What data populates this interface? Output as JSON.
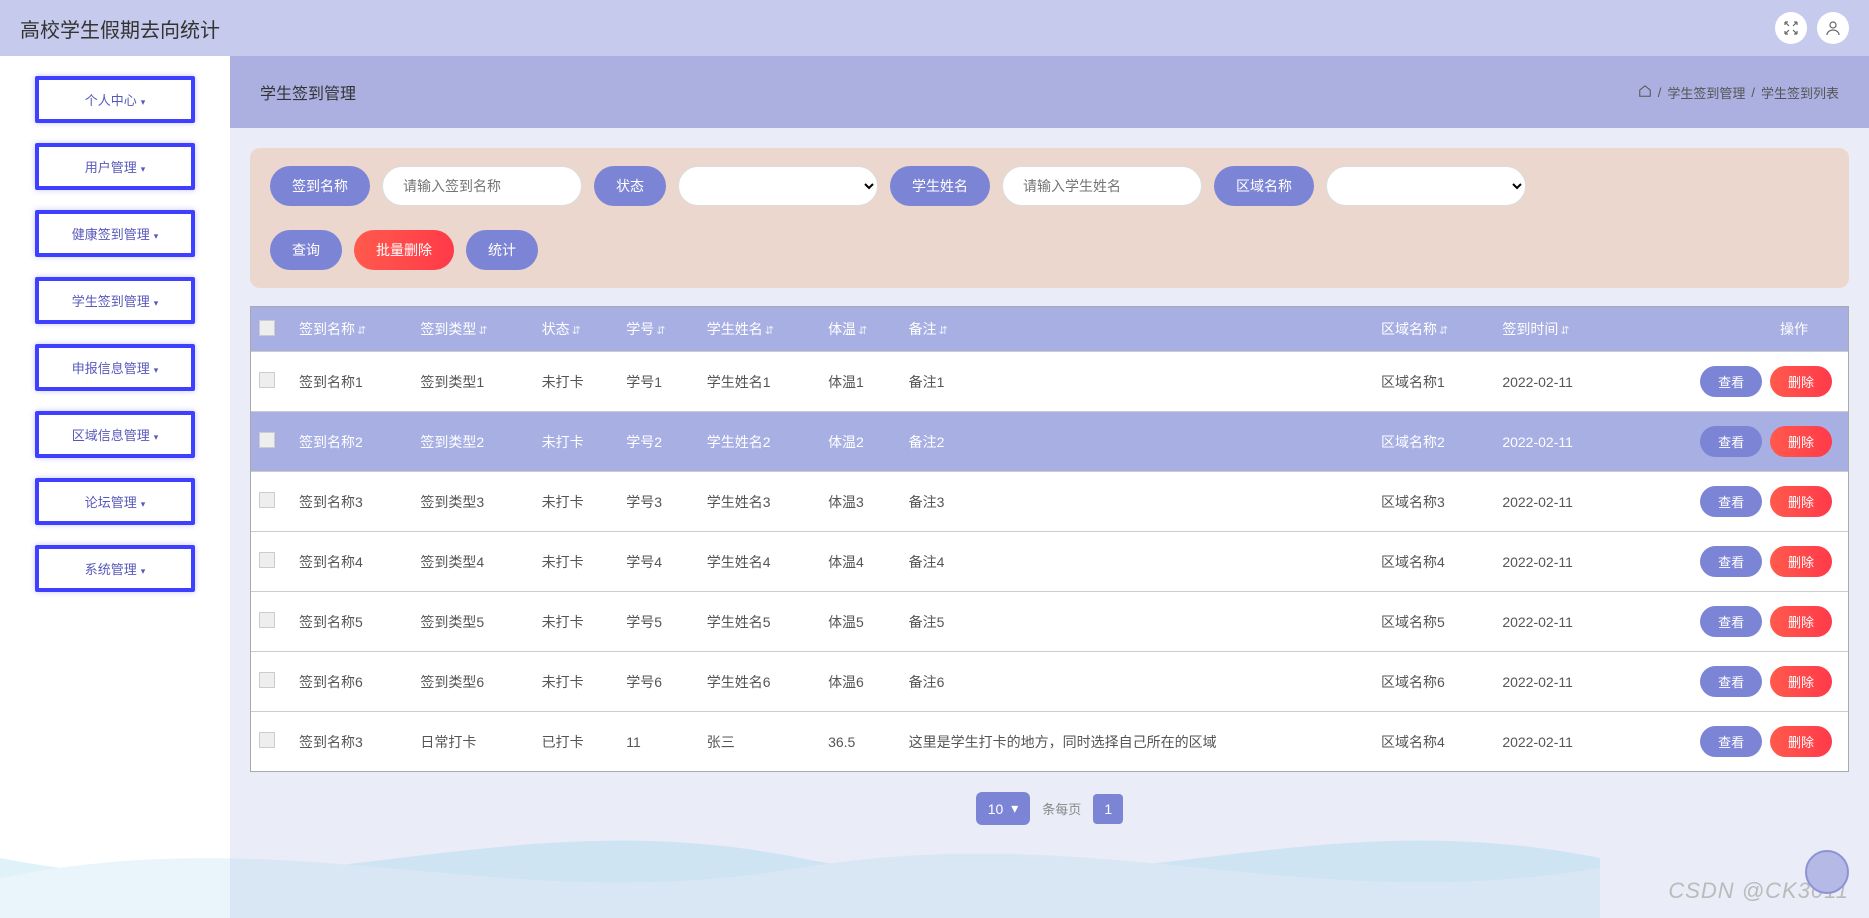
{
  "header": {
    "title": "高校学生假期去向统计"
  },
  "sidebar": {
    "items": [
      {
        "label": "个人中心"
      },
      {
        "label": "用户管理"
      },
      {
        "label": "健康签到管理"
      },
      {
        "label": "学生签到管理"
      },
      {
        "label": "申报信息管理"
      },
      {
        "label": "区域信息管理"
      },
      {
        "label": "论坛管理"
      },
      {
        "label": "系统管理"
      }
    ]
  },
  "breadcrumb": {
    "title": "学生签到管理",
    "sep": "/",
    "item1": "学生签到管理",
    "item2": "学生签到列表"
  },
  "filters": {
    "name_label": "签到名称",
    "name_placeholder": "请输入签到名称",
    "status_label": "状态",
    "student_label": "学生姓名",
    "student_placeholder": "请输入学生姓名",
    "area_label": "区域名称",
    "query_btn": "查询",
    "batch_delete_btn": "批量删除",
    "stats_btn": "统计"
  },
  "table": {
    "headers": {
      "name": "签到名称",
      "type": "签到类型",
      "status": "状态",
      "sid": "学号",
      "sname": "学生姓名",
      "temp": "体温",
      "remark": "备注",
      "area": "区域名称",
      "time": "签到时间",
      "ops": "操作"
    },
    "view_btn": "查看",
    "delete_btn": "删除",
    "rows": [
      {
        "name": "签到名称1",
        "type": "签到类型1",
        "status": "未打卡",
        "sid": "学号1",
        "sname": "学生姓名1",
        "temp": "体温1",
        "remark": "备注1",
        "area": "区域名称1",
        "time": "2022-02-11"
      },
      {
        "name": "签到名称2",
        "type": "签到类型2",
        "status": "未打卡",
        "sid": "学号2",
        "sname": "学生姓名2",
        "temp": "体温2",
        "remark": "备注2",
        "area": "区域名称2",
        "time": "2022-02-11"
      },
      {
        "name": "签到名称3",
        "type": "签到类型3",
        "status": "未打卡",
        "sid": "学号3",
        "sname": "学生姓名3",
        "temp": "体温3",
        "remark": "备注3",
        "area": "区域名称3",
        "time": "2022-02-11"
      },
      {
        "name": "签到名称4",
        "type": "签到类型4",
        "status": "未打卡",
        "sid": "学号4",
        "sname": "学生姓名4",
        "temp": "体温4",
        "remark": "备注4",
        "area": "区域名称4",
        "time": "2022-02-11"
      },
      {
        "name": "签到名称5",
        "type": "签到类型5",
        "status": "未打卡",
        "sid": "学号5",
        "sname": "学生姓名5",
        "temp": "体温5",
        "remark": "备注5",
        "area": "区域名称5",
        "time": "2022-02-11"
      },
      {
        "name": "签到名称6",
        "type": "签到类型6",
        "status": "未打卡",
        "sid": "学号6",
        "sname": "学生姓名6",
        "temp": "体温6",
        "remark": "备注6",
        "area": "区域名称6",
        "time": "2022-02-11"
      },
      {
        "name": "签到名称3",
        "type": "日常打卡",
        "status": "已打卡",
        "sid": "11",
        "sname": "张三",
        "temp": "36.5",
        "remark": "这里是学生打卡的地方，同时选择自己所在的区域",
        "area": "区域名称4",
        "time": "2022-02-11"
      }
    ]
  },
  "pagination": {
    "size": "10",
    "per_page_label": "条每页",
    "current": "1"
  },
  "watermark": "CSDN @CK3011"
}
